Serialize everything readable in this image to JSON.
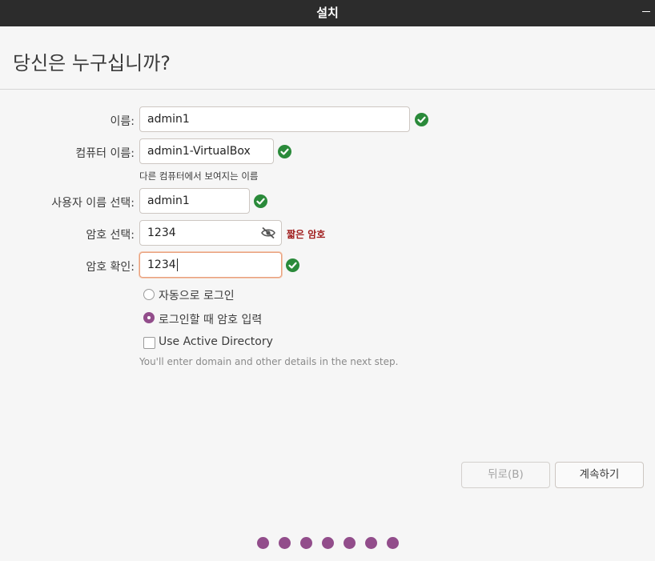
{
  "window": {
    "title": "설치"
  },
  "page": {
    "heading": "당신은 누구십니까?"
  },
  "form": {
    "name": {
      "label": "이름:",
      "value": "admin1"
    },
    "computer": {
      "label": "컴퓨터 이름:",
      "value": "admin1-VirtualBox",
      "hint": "다른 컴퓨터에서 보여지는 이름"
    },
    "username": {
      "label": "사용자 이름 선택:",
      "value": "admin1"
    },
    "password": {
      "label": "암호 선택:",
      "value": "1234",
      "strength": "짧은 암호"
    },
    "confirm": {
      "label": "암호 확인:",
      "value": "1234"
    },
    "login_options": [
      {
        "label": "자동으로 로그인",
        "selected": false
      },
      {
        "label": "로그인할 때 암호 입력",
        "selected": true
      }
    ],
    "active_directory": {
      "label": "Use Active Directory",
      "checked": false,
      "note": "You'll enter domain and other details in the next step."
    }
  },
  "buttons": {
    "back": "뒤로(B)",
    "continue": "계속하기"
  },
  "progress": {
    "total_steps": 7,
    "completed_steps": 7
  },
  "colors": {
    "accent": "#924d8b",
    "valid": "#2a8a3a",
    "warning": "#a01e1e",
    "titlebar": "#2c2c2c"
  }
}
